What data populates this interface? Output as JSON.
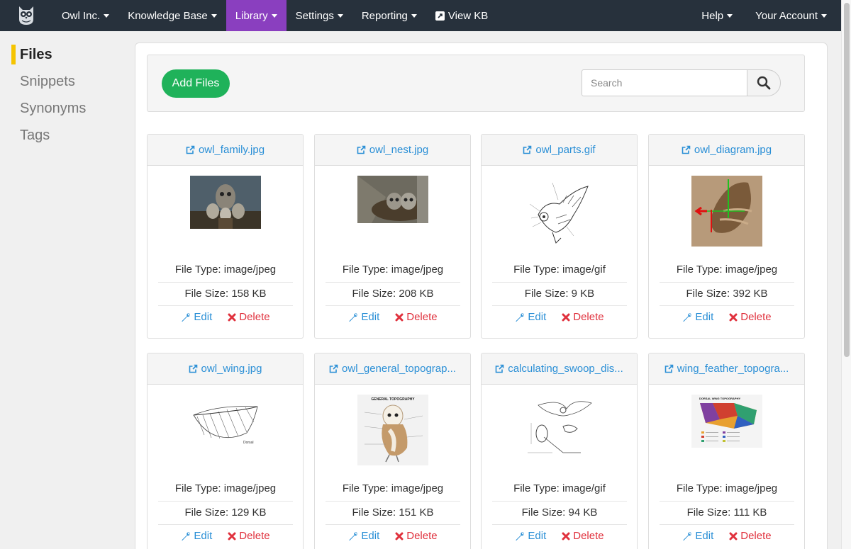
{
  "navbar": {
    "logo_icon": "owl-logo-icon",
    "items": [
      {
        "label": "Owl Inc.",
        "caret": true,
        "active": false
      },
      {
        "label": "Knowledge Base",
        "caret": true,
        "active": false
      },
      {
        "label": "Library",
        "caret": true,
        "active": true
      },
      {
        "label": "Settings",
        "caret": true,
        "active": false
      },
      {
        "label": "Reporting",
        "caret": true,
        "active": false
      },
      {
        "label": "View KB",
        "caret": false,
        "active": false,
        "icon": "external-link-icon"
      }
    ],
    "right_items": [
      {
        "label": "Help",
        "caret": true
      },
      {
        "label": "Your Account",
        "caret": true
      }
    ],
    "colors": {
      "background": "#27313c",
      "active": "#8a3fbf"
    }
  },
  "sidebar": {
    "items": [
      {
        "label": "Files",
        "active": true
      },
      {
        "label": "Snippets",
        "active": false
      },
      {
        "label": "Synonyms",
        "active": false
      },
      {
        "label": "Tags",
        "active": false
      }
    ],
    "accent_color": "#f5c400"
  },
  "toolbar": {
    "add_files_label": "Add Files",
    "search_placeholder": "Search",
    "search_icon": "search-icon",
    "add_button_color": "#1fb25a"
  },
  "card_labels": {
    "file_type_prefix": "File Type: ",
    "file_size_prefix": "File Size: ",
    "edit_label": "Edit",
    "delete_label": "Delete"
  },
  "files": [
    {
      "name": "owl_family.jpg",
      "type": "image/jpeg",
      "size": "158 KB",
      "thumb": "photo-family"
    },
    {
      "name": "owl_nest.jpg",
      "type": "image/jpeg",
      "size": "208 KB",
      "thumb": "photo-nest"
    },
    {
      "name": "owl_parts.gif",
      "type": "image/gif",
      "size": "9 KB",
      "thumb": "sketch-parts"
    },
    {
      "name": "owl_diagram.jpg",
      "type": "image/jpeg",
      "size": "392 KB",
      "thumb": "photo-diagram"
    },
    {
      "name": "owl_wing.jpg",
      "type": "image/jpeg",
      "size": "129 KB",
      "thumb": "sketch-wing"
    },
    {
      "name": "owl_general_topograp...",
      "type": "image/jpeg",
      "size": "151 KB",
      "thumb": "chart-topography"
    },
    {
      "name": "calculating_swoop_dis...",
      "type": "image/gif",
      "size": "94 KB",
      "thumb": "sketch-swoop"
    },
    {
      "name": "wing_feather_topogra...",
      "type": "image/jpeg",
      "size": "111 KB",
      "thumb": "chart-feather"
    }
  ],
  "colors": {
    "link": "#2a8fd6",
    "delete": "#e0313d"
  }
}
